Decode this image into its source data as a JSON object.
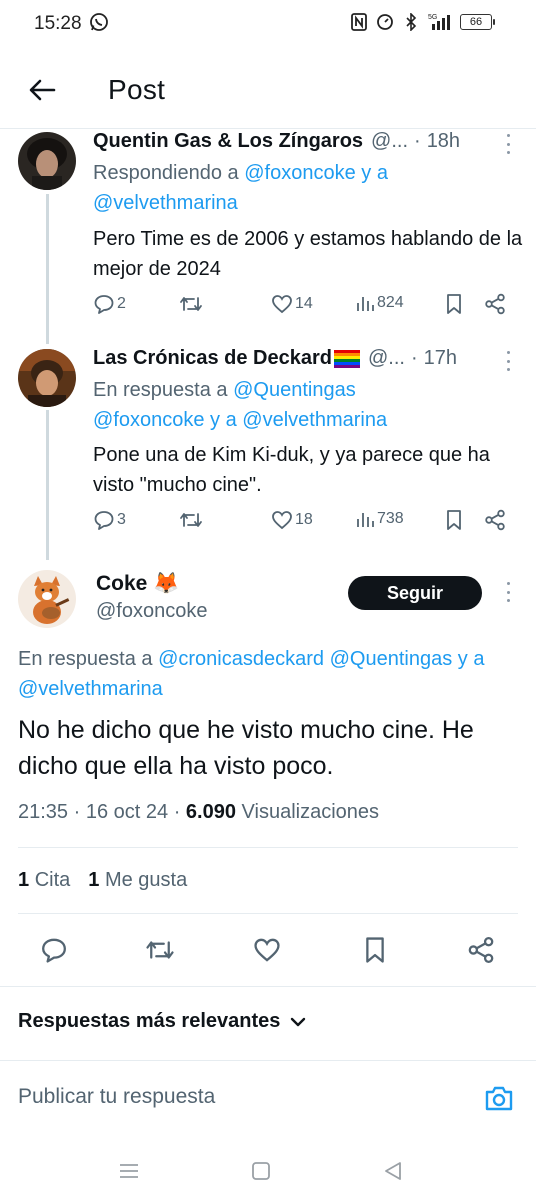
{
  "status_bar": {
    "time": "15:28",
    "network": "5G",
    "battery": "66"
  },
  "header": {
    "title": "Post"
  },
  "replies": [
    {
      "name": "Quentin Gas & Los Zíngaros",
      "handle": "@...",
      "time": "18h",
      "context_prefix": "Respondiendo a",
      "context_link1": "@foxoncoke",
      "context_and": "y a",
      "context_link2": "@velvethmarina",
      "text": "Pero Time es de 2006 y estamos hablando de la mejor de 2024",
      "replies_count": "2",
      "likes_count": "14",
      "views_count": "824"
    },
    {
      "name": "Las Crónicas de Deckard",
      "handle": "@...",
      "time": "17h",
      "context_prefix": "En respuesta a",
      "context_link1": "@Quentingas",
      "context_link2": "@foxoncoke",
      "context_and": "y a",
      "context_link3": "@velvethmarina",
      "text": "Pone una de Kim Ki-duk, y ya parece que ha visto \"mucho cine\".",
      "replies_count": "3",
      "likes_count": "18",
      "views_count": "738"
    }
  ],
  "main_tweet": {
    "name": "Coke",
    "name_emoji": "🦊",
    "handle": "@foxoncoke",
    "follow_label": "Seguir",
    "context_prefix": "En respuesta a",
    "context_link1": "@cronicasdeckard",
    "context_link2": "@Quentingas",
    "context_and": "y a",
    "context_link3": "@velvethmarina",
    "text": "No he dicho que he visto mucho cine. He dicho que ella ha visto poco.",
    "time": "21:35",
    "date": "16 oct 24",
    "views_num": "6.090",
    "views_label": "Visualizaciones",
    "quotes_num": "1",
    "quotes_label": "Cita",
    "likes_num": "1",
    "likes_label": "Me gusta"
  },
  "sort": {
    "label": "Respuestas más relevantes"
  },
  "reply_bar": {
    "placeholder": "Publicar tu respuesta"
  },
  "colors": {
    "link": "#1d9bf0",
    "muted": "#536471",
    "text": "#0f1419",
    "follow_bg": "#0f1419"
  }
}
